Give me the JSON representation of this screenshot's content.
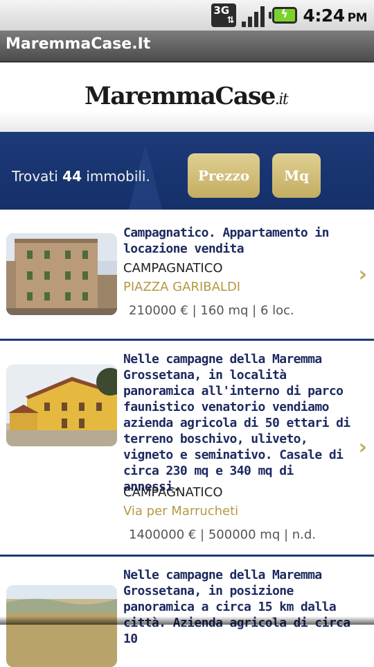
{
  "status_bar": {
    "network": "3G",
    "time": "4:24",
    "ampm": "PM",
    "icons": [
      "3g-data-icon",
      "signal-icon",
      "battery-charging-icon"
    ]
  },
  "app": {
    "title": "MaremmaCase.It"
  },
  "logo": {
    "main": "MaremmaCase",
    "suffix": ".it"
  },
  "results": {
    "prefix": "Trovati",
    "count": "44",
    "suffix": "immobili."
  },
  "sort_buttons": {
    "price": "Prezzo",
    "area": "Mq"
  },
  "listings": [
    {
      "title": "Campagnatico. Appartamento in locazione vendita",
      "city": "CAMPAGNATICO",
      "address": "PIAZZA GARIBALDI",
      "meta": "210000 € | 160 mq | 6 loc."
    },
    {
      "title": "Nelle campagne della Maremma Grossetana, in località panoramica all'interno di parco faunistico venatorio vendiamo azienda agricola di 50 ettari di terreno boschivo, uliveto, vigneto e seminativo. Casale di circa 230 mq e 340 mq di annessi.",
      "city": "CAMPAGNATICO",
      "address": "Via per Marrucheti",
      "meta": "1400000 € | 500000 mq | n.d."
    },
    {
      "title": "Nelle campagne della Maremma Grossetana, in posizione panoramica a circa 15 km dalla città. Azienda agricola di circa 10"
    }
  ],
  "colors": {
    "navy": "#1d3a78",
    "gold": "#c4ad62",
    "title_text": "#1d2a60"
  }
}
